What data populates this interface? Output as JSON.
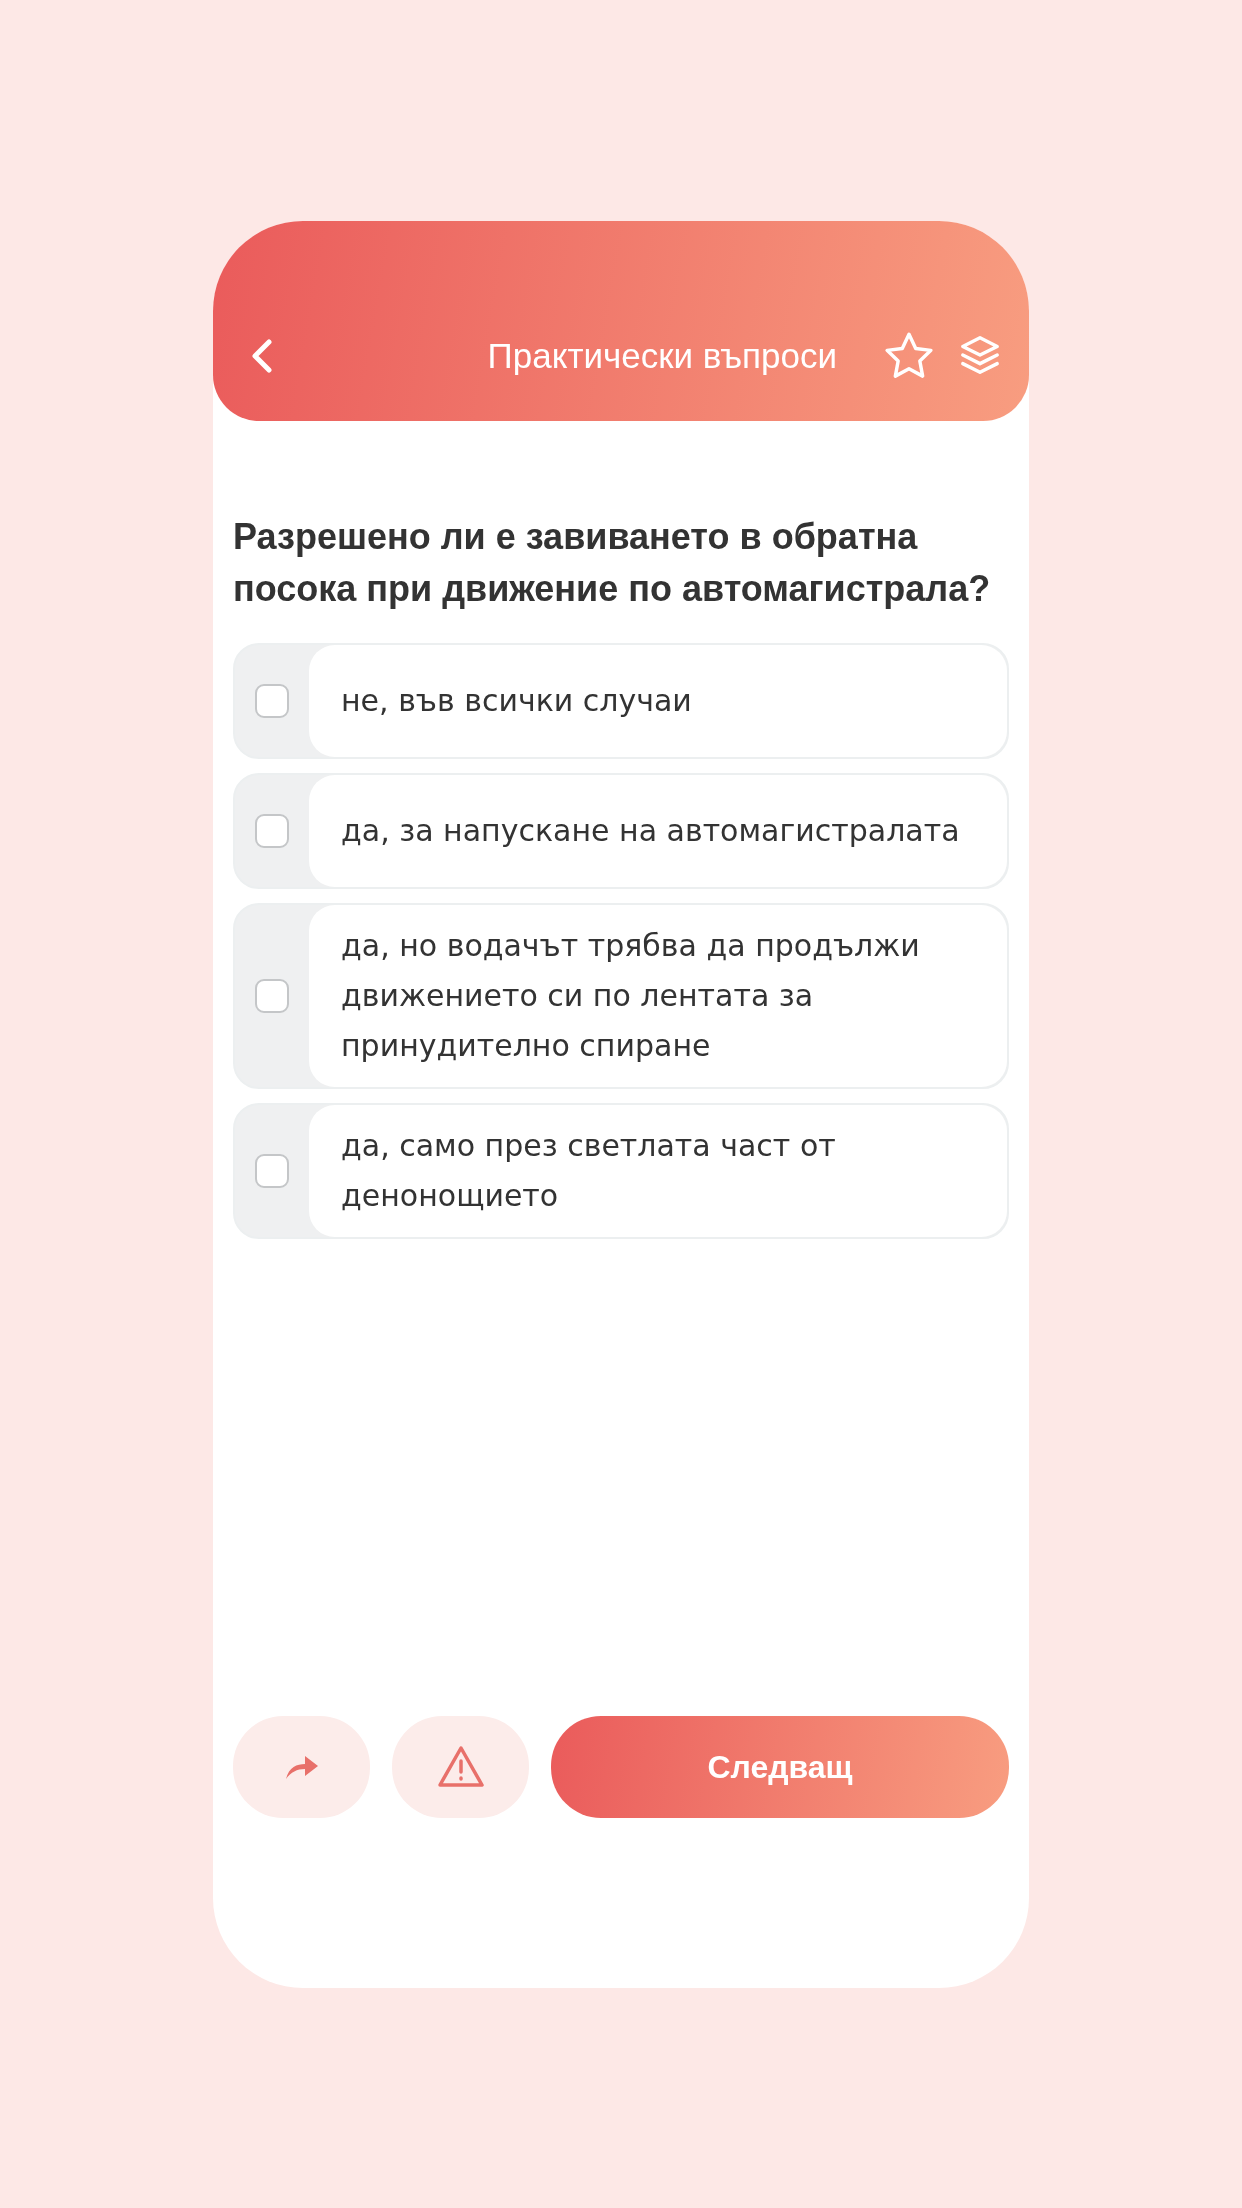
{
  "header": {
    "title": "Практически въпроси"
  },
  "question": "Разрешено ли е завиването в обратна посока при движение по автомагистрала?",
  "options": [
    {
      "text": "не, във всички случаи",
      "checked": false
    },
    {
      "text": "да, за напускане на автомагистралата",
      "checked": false
    },
    {
      "text": "да, но водачът трябва да продължи движението си по лентата за принудително спиране",
      "checked": false
    },
    {
      "text": "да, само през светлата част от денонощието",
      "checked": false
    }
  ],
  "next_button": "Следващ"
}
